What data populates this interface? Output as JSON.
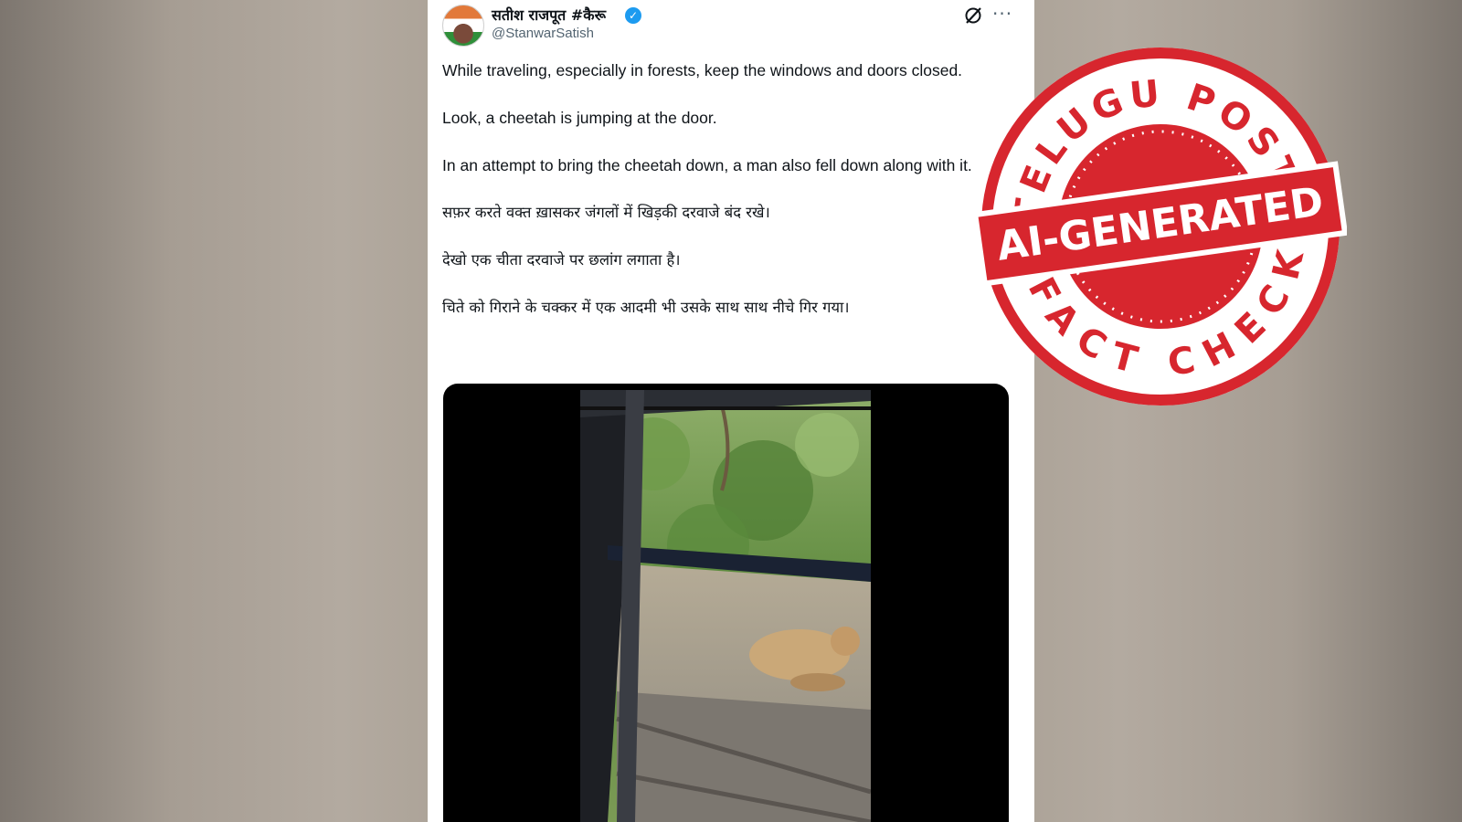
{
  "tweet": {
    "display_name": "सतीश राजपूत #कैरू",
    "handle": "@StanwarSatish",
    "verified_mark": "✓",
    "more_label": "···",
    "paragraphs": [
      "While traveling, especially in forests, keep the windows and doors closed.",
      "Look, a cheetah is jumping at the door.",
      "In an attempt to bring the cheetah down, a man also fell down along with it.",
      "सफ़र करते वक्त ख़ासकर जंगलों में खिड़की दरवाजे बंद रखे।",
      "देखो एक चीता दरवाजे पर छलांग लगाता है।",
      "चिते को गिराने के चक्कर में एक आदमी भी उसके साथ साथ नीचे गिर गया।"
    ]
  },
  "stamp": {
    "top_text": "TELUGU POST",
    "band_text": "AI-GENERATED",
    "bottom_text": "FACT CHECK",
    "color": "#d7262e"
  },
  "icons": {
    "grok": "grok-icon",
    "more": "more-icon",
    "verified": "verified-badge-icon"
  }
}
